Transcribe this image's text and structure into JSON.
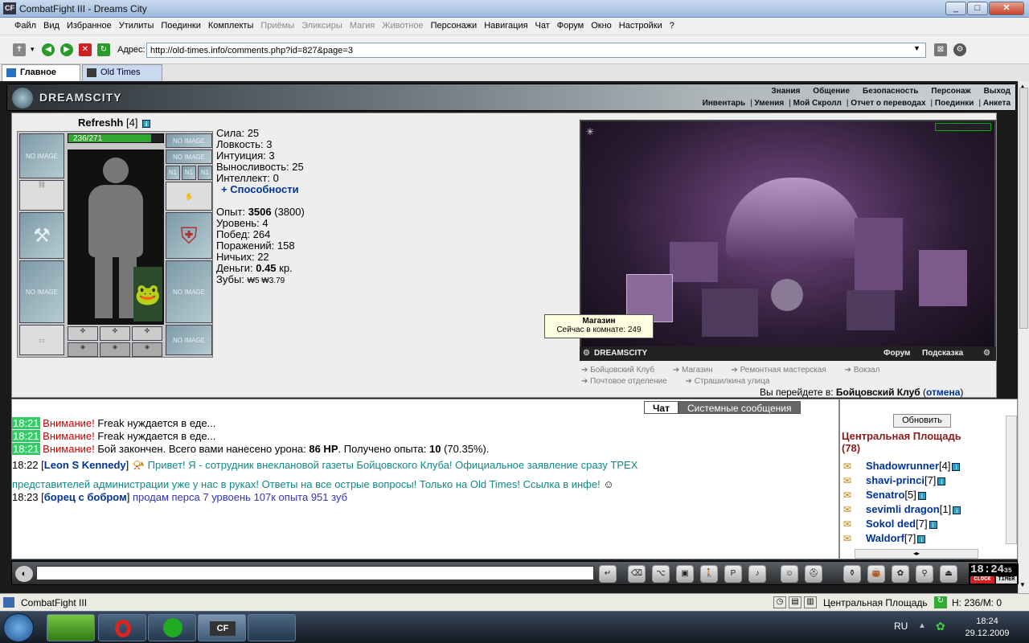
{
  "window": {
    "title": "CombatFight III - Dreams City",
    "app_icon": "CF",
    "min": "_",
    "max": "□",
    "close": "✕"
  },
  "menu": [
    "Файл",
    "Вид",
    "Избранное",
    "Утилиты",
    "Поединки",
    "Комплекты",
    "Приёмы",
    "Эликсиры",
    "Магия",
    "Животное",
    "Персонажи",
    "Навигация",
    "Чат",
    "Форум",
    "Окно",
    "Настройки",
    "?"
  ],
  "menu_disabled": [
    "Приёмы",
    "Эликсиры",
    "Магия",
    "Животное"
  ],
  "address": {
    "label": "Адрес:",
    "url": "http://old-times.info/comments.php?id=827&page=3"
  },
  "tabs": [
    {
      "label": "Главное"
    },
    {
      "label": "Old Times"
    }
  ],
  "game": {
    "logo": "DREAMSCITY",
    "nav_top": [
      "Знания",
      "Общение",
      "Безопасность",
      "Персонаж",
      "Выход"
    ],
    "nav_bottom": [
      "Инвентарь",
      "Умения",
      "Мой Скролл",
      "Отчет о переводах",
      "Поединки",
      "Анкета"
    ]
  },
  "character": {
    "name": "Refreshh",
    "level": "[4]",
    "hp_text": "236/271",
    "hp_fraction": 0.871,
    "no_image": "NO IMAGE",
    "n1": "N1",
    "stats": [
      {
        "label": "Сила:",
        "value": "25"
      },
      {
        "label": "Ловкость:",
        "value": "3"
      },
      {
        "label": "Интуиция:",
        "value": "3"
      },
      {
        "label": "Выносливость:",
        "value": "25"
      },
      {
        "label": "Интеллект:",
        "value": "0"
      }
    ],
    "abilities": "+ Способности",
    "exp_label": "Опыт:",
    "exp_value": "3506",
    "exp_next": "(3800)",
    "level_label": "Уровень:",
    "level_value": "4",
    "wins_label": "Побед:",
    "wins_value": "264",
    "losses_label": "Поражений:",
    "losses_value": "158",
    "draws_label": "Ничьих:",
    "draws_value": "22",
    "money_label": "Деньги:",
    "money_value": "0.45",
    "money_unit": "кр.",
    "teeth_label": "Зубы:",
    "teeth_value": "₩5 ₩3.79"
  },
  "map": {
    "tooltip_title": "Магазин",
    "tooltip_text": "Сейчас в комнате: 249",
    "footer_logo": "DREAMSCITY",
    "footer_links": [
      "Форум",
      "Подсказка"
    ],
    "room_links": [
      "Бойцовский Клуб",
      "Магазин",
      "Ремонтная мастерская",
      "Вокзал",
      "Почтовое отделение",
      "Страшилкина улица"
    ],
    "goto_text": "Вы перейдете в:",
    "goto_target": "Бойцовский Клуб",
    "goto_cancel": "отмена"
  },
  "chat": {
    "tabs": [
      "Чат",
      "Системные сообщения"
    ],
    "messages": [
      {
        "time": "18:21",
        "label": "Внимание!",
        "text": "Freak нуждается в еде..."
      },
      {
        "time": "18:21",
        "label": "Внимание!",
        "text": "Freak нуждается в еде..."
      },
      {
        "time": "18:21",
        "label": "Внимание!",
        "text": "Бой закончен. Всего вами нанесено урона: ",
        "b1": "86 HP",
        "t2": ". Получено опыта: ",
        "b2": "10",
        "t3": " (70.35%)."
      },
      {
        "time": "18:22",
        "sender": "Leon S Kennedy",
        "text": " Привет! Я - сотрудник внеклановой газеты Бойцовского Клуба! Официальное заявление сразу ТРЕХ",
        "text2": "представителей администрации уже у нас в руках! Ответы на все острые вопросы! Только на Old Times! Ссылка в инфе!"
      },
      {
        "time": "18:23",
        "sender": "борец с бобром",
        "text": " продам перса 7 урвоень 107к опыта 951 зуб"
      }
    ]
  },
  "users": {
    "refresh": "Обновить",
    "room": "Центральная Площадь",
    "count": "(78)",
    "list": [
      {
        "name": "Shadowrunner",
        "level": "[4]"
      },
      {
        "name": "shavi-princi",
        "level": "[7]"
      },
      {
        "name": "Senatro",
        "level": "[5]"
      },
      {
        "name": "sevimli dragon",
        "level": "[1]"
      },
      {
        "name": "Sokol ded",
        "level": "[7]"
      },
      {
        "name": "Waldorf",
        "level": "[7]"
      }
    ]
  },
  "clock": {
    "time": "18:24",
    "sec": "35",
    "clock_label": "CLOCK",
    "timer_label": "TIMER"
  },
  "status": {
    "title": "CombatFight III",
    "room": "Центральная Площадь",
    "hp": "H: 236/M: 0"
  },
  "taskbar": {
    "lang": "RU",
    "time": "18:24",
    "date": "29.12.2009"
  }
}
